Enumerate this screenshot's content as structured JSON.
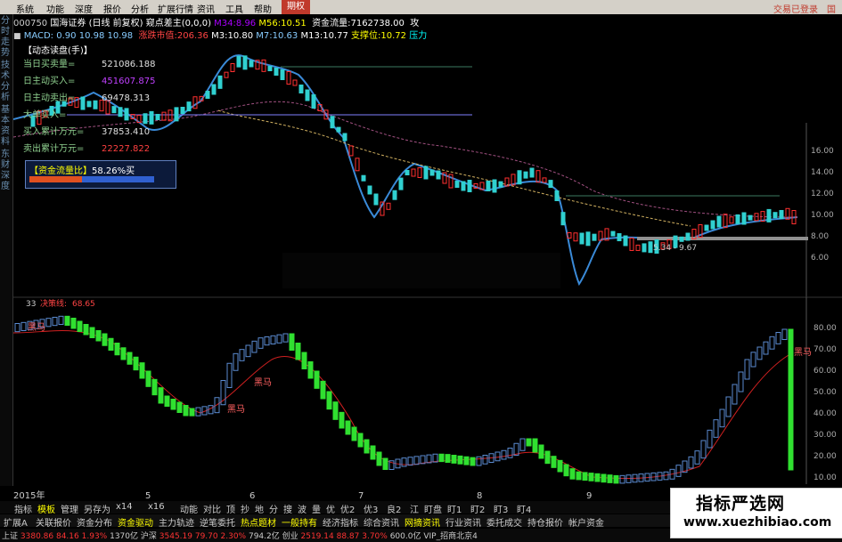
{
  "menu": {
    "items": [
      "系统",
      "功能",
      "深度",
      "报价",
      "分析",
      "扩展行情",
      "资讯",
      "工具",
      "帮助"
    ],
    "active": "期权",
    "right": [
      "交易已登录",
      "国"
    ]
  },
  "stock_bar": {
    "code": "000750",
    "name": "国海证券",
    "mode": "(日线 前复权)",
    "indicator": "窥点差主(0,0,0)",
    "m34_label": "M34:",
    "m34": "8.96",
    "m56_label": "M56:",
    "m56": "10.51",
    "fund_flow_label": "资金流量:",
    "fund_flow": "7162738.00",
    "extra": "攻"
  },
  "indicator_bar": {
    "macd_label": "MACD:",
    "v1": "0.90",
    "v2": "10.98",
    "v3": "10.98",
    "trend_label": "涨跌市值:",
    "trend": "206.36",
    "m3_label": "M3:",
    "m3": "10.80",
    "m7_label": "M7:",
    "m7": "10.63",
    "m13_label": "M13:",
    "m13": "10.77",
    "support_label": "支撑位:",
    "support": "10.72",
    "pressure": "压力"
  },
  "dynamic_panel": {
    "title": "【动态读盘(手)】",
    "rows": [
      {
        "label": "当日买卖量=",
        "value": "521086.188",
        "color": "#e0e0e0"
      },
      {
        "label": "日主动买入=",
        "value": "451607.875",
        "color": "#c040ff"
      },
      {
        "label": "日主动卖出=",
        "value": "69478.313",
        "color": "#e0e0e0"
      },
      {
        "label": "大单买入=",
        "value": "",
        "color": "#e0e0e0"
      },
      {
        "label": "买入累计万元=",
        "value": "37853.410",
        "color": "#e0e0e0"
      },
      {
        "label": "卖出累计万元=",
        "value": "22227.822",
        "color": "#ff4040"
      }
    ],
    "ratio_label": "【资金流量比】",
    "ratio_value": "58.26%买",
    "ratio_red": 0.42
  },
  "sidebar_tabs": [
    "分时走势",
    "技术分析",
    "基本资料",
    "东财深度"
  ],
  "price_axis": [
    "16.00",
    "14.00",
    "12.00",
    "10.00",
    "8.00",
    "6.00"
  ],
  "range_label": "5.34 - 9.67",
  "lower_panel": {
    "label": "33",
    "name": "决策线:",
    "value": "68.65",
    "axis": [
      "80.00",
      "70.00",
      "60.00",
      "50.00",
      "40.00",
      "30.00",
      "20.00",
      "10.00"
    ],
    "annotations": [
      "黑马",
      "黑马",
      "黑马",
      "黑马"
    ]
  },
  "x_axis": {
    "year": "2015年",
    "months": [
      "5",
      "6",
      "7",
      "8",
      "9"
    ]
  },
  "tabs_row1": [
    "指标",
    "模板",
    "管理",
    "另存为",
    "x14",
    "x16",
    "动能",
    "对比",
    "顶",
    "抄",
    "地",
    "分",
    "搜",
    "波",
    "量",
    "优",
    "优2",
    "优3",
    "良2",
    "江",
    "盯盘",
    "盯1",
    "盯2",
    "盯3",
    "盯4"
  ],
  "tabs_row2": [
    "扩展A",
    "关联报价",
    "资金分布",
    "资金驱动",
    "主力轨迹",
    "逆笔委托",
    "热点题材",
    "一般持有",
    "经济指标",
    "综合资讯",
    "网摘资讯",
    "行业资讯",
    "委托成交",
    "持仓报价",
    "帐户资金"
  ],
  "status": {
    "sh_label": "上证",
    "sh_val": "3380.86",
    "sh_chg": "84.16",
    "sh_pct": "1.93%",
    "sh_amt": "1370亿",
    "sz_label": "沪深",
    "sz_val": "3545.19",
    "sz_chg": "79.70",
    "sz_pct": "2.30%",
    "sz_amt": "794.2亿",
    "cy_label": "创业",
    "cy_val": "2519.14",
    "cy_chg": "88.87",
    "cy_pct": "3.70%",
    "cy_amt": "600.0亿",
    "vip": "VIP_招商北京4"
  },
  "watermark": {
    "cn": "指标严选网",
    "url": "www.xuezhibiao.com"
  },
  "colors": {
    "up": "#ff3030",
    "down": "#30d0d0",
    "accent": "#c0392b",
    "green": "#30e030"
  }
}
